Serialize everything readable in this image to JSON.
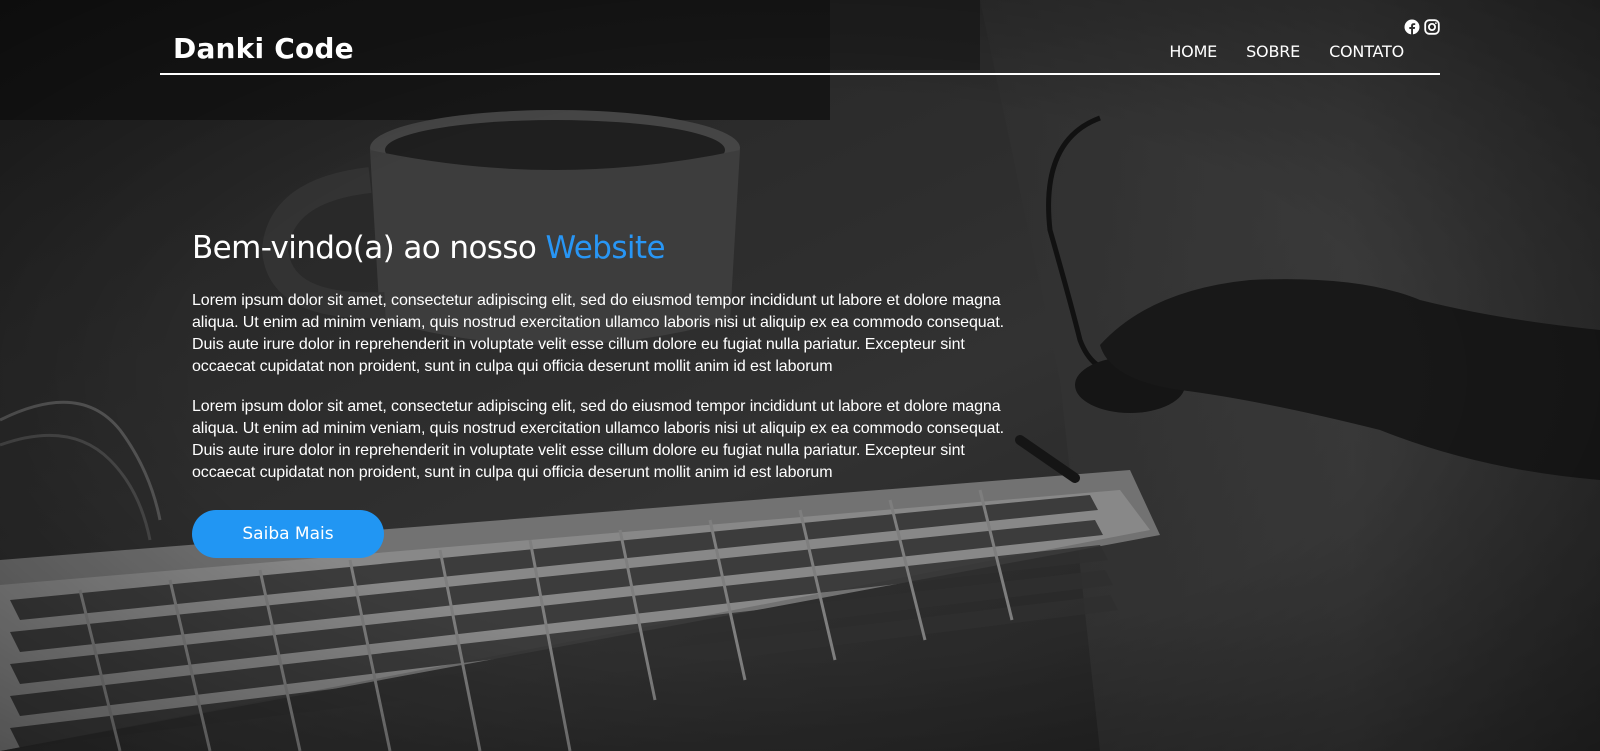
{
  "brand": {
    "logo_text": "Danki Code"
  },
  "header": {
    "social": [
      {
        "icon": "facebook-icon"
      },
      {
        "icon": "instagram-icon"
      }
    ],
    "nav": [
      {
        "label": "HOME"
      },
      {
        "label": "SOBRE"
      },
      {
        "label": "CONTATO"
      }
    ]
  },
  "hero": {
    "headline_prefix": "Bem-vindo(a) ao nosso ",
    "headline_accent": "Website",
    "paragraphs": [
      "Lorem ipsum dolor sit amet, consectetur adipiscing elit, sed do eiusmod tempor incididunt ut labore et dolore magna aliqua. Ut enim ad minim veniam, quis nostrud exercitation ullamco laboris nisi ut aliquip ex ea commodo consequat. Duis aute irure dolor in reprehenderit in voluptate velit esse cillum dolore eu fugiat nulla pariatur. Excepteur sint occaecat cupidatat non proident, sunt in culpa qui officia deserunt mollit anim id est laborum",
      "Lorem ipsum dolor sit amet, consectetur adipiscing elit, sed do eiusmod tempor incididunt ut labore et dolore magna aliqua. Ut enim ad minim veniam, quis nostrud exercitation ullamco laboris nisi ut aliquip ex ea commodo consequat. Duis aute irure dolor in reprehenderit in voluptate velit esse cillum dolore eu fugiat nulla pariatur. Excepteur sint occaecat cupidatat non proident, sunt in culpa qui officia deserunt mollit anim id est laborum"
    ],
    "cta_label": "Saiba Mais"
  },
  "colors": {
    "accent": "#2896f5",
    "button": "#2196f3",
    "text": "#ffffff"
  }
}
